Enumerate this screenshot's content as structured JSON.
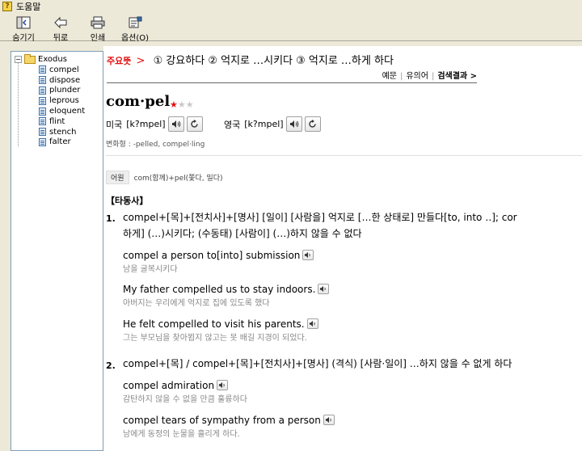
{
  "window": {
    "title": "도움말"
  },
  "toolbar": {
    "hide_label": "숨기기",
    "back_label": "뒤로",
    "print_label": "인쇄",
    "options_label": "옵션(O)"
  },
  "tree": {
    "root": "Exodus",
    "items": [
      "compel",
      "dispose",
      "plunder",
      "leprous",
      "eloquent",
      "flint",
      "stench",
      "falter"
    ]
  },
  "entry": {
    "meaning_key": "주요뜻",
    "meaning_arrow": ">",
    "meanings": "① 강요하다 ② 억지로 …시키다 ③ 억지로 …하게 하다",
    "links": [
      "예문",
      "유의어",
      "검색결과 >"
    ],
    "headword": "com·pel",
    "stars_on": "★",
    "stars_off": "★★",
    "pron_us_label": "미국",
    "pron_us": "[k?mpel]",
    "pron_uk_label": "영국",
    "pron_uk": "[k?mpel]",
    "inflection": "변화형 : -pelled, compel·ling",
    "etym_tag": "어원",
    "etym_text": "com(함께)+pel(쫓다, 밀다)",
    "pos": "【타동사】",
    "senses": [
      {
        "num": "1.",
        "line1": "compel+[목]+[전치사]+[명사] [일이] [사람을] 억지로 […한 상태로] 만들다[to, into ‥]; cor",
        "line2": "하게] (…)시키다; (수동태) [사람이] (…)하지 않을 수 없다",
        "examples": [
          {
            "en": "compel a person to[into] submission",
            "ko": "남을 굴복시키다"
          },
          {
            "en": "My father compelled us to stay indoors.",
            "ko": "아버지는 우리에게 억지로 집에 있도록 했다"
          },
          {
            "en": "He felt compelled to visit his parents.",
            "ko": "그는 부모님을 찾아뵙지 않고는 못 배길 지경이 되었다."
          }
        ]
      },
      {
        "num": "2.",
        "line1": "compel+[목] / compel+[목]+[전치사]+[명사] (격식) [사람·일이] …하지 않을 수 없게 하다",
        "examples": [
          {
            "en": "compel admiration",
            "ko": "감탄하지 않을 수 없을 만큼 훌륭하다"
          },
          {
            "en": "compel tears of sympathy from a person",
            "ko": "남에게 동정의 눈물을 흘리게 하다."
          }
        ]
      }
    ]
  }
}
